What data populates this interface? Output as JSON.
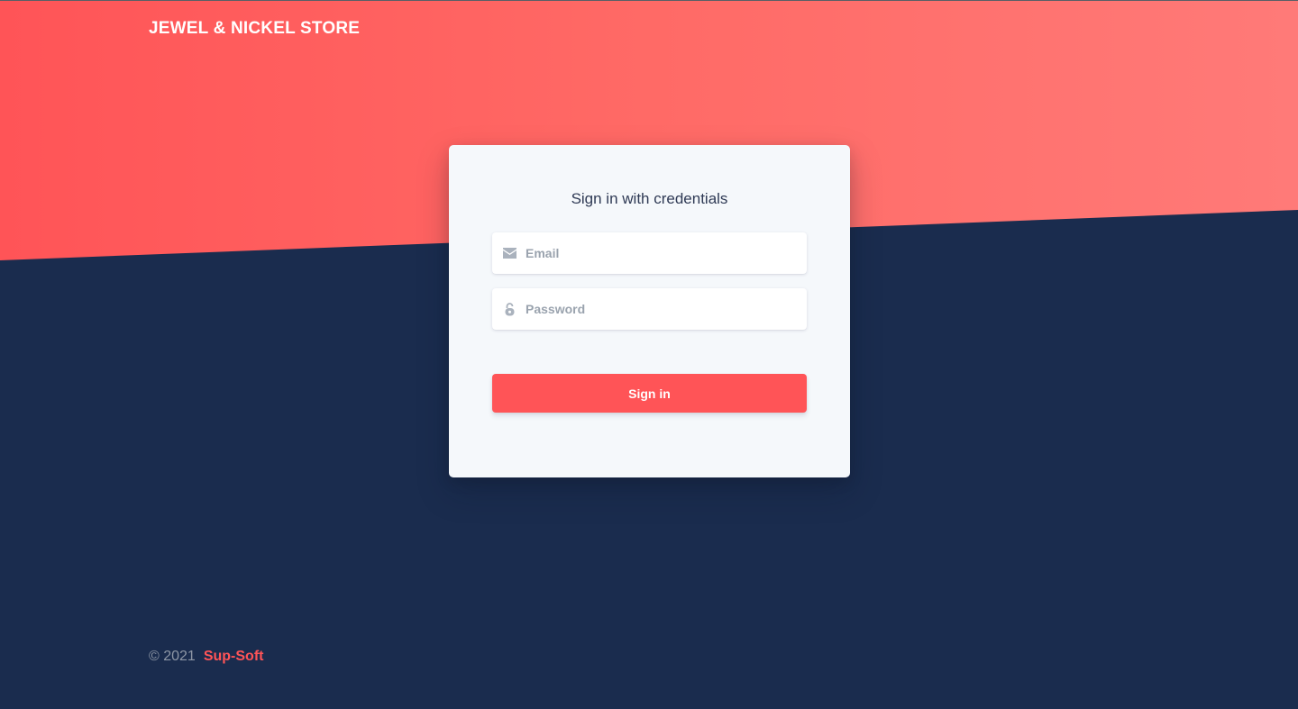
{
  "brand": {
    "name": "JEWEL & NICKEL STORE"
  },
  "login": {
    "title": "Sign in with credentials",
    "email": {
      "placeholder": "Email",
      "value": "",
      "icon": "envelope-icon"
    },
    "password": {
      "placeholder": "Password",
      "value": "",
      "icon": "lock-icon"
    },
    "submit_label": "Sign in"
  },
  "footer": {
    "copyright": "© 2021",
    "company": "Sup-Soft"
  },
  "colors": {
    "accent": "#ff5457",
    "background": "#1a2c4e",
    "card": "#f5f8fb"
  }
}
